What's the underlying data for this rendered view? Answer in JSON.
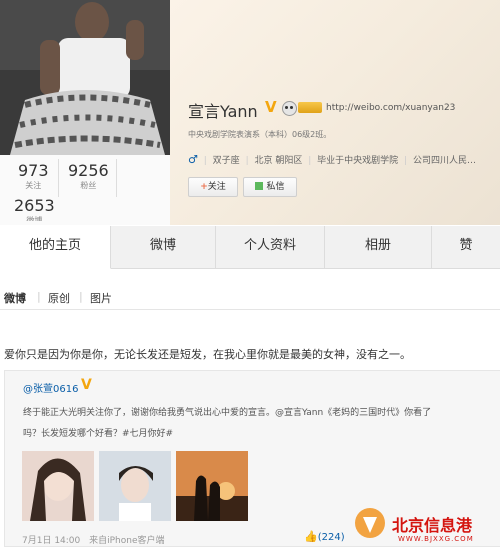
{
  "profile": {
    "name": "宣言Yann",
    "url": "http://weibo.com/xuanyan23",
    "bio": "中央戏剧学院表演系（本科）06级2班。",
    "info": [
      "双子座",
      "北京 朝阳区",
      "毕业于中央戏剧学院",
      "公司四川人民…"
    ],
    "follow_label": "关注",
    "message_label": "私信"
  },
  "stats": {
    "following_count": "973",
    "following_label": "关注",
    "fans_count": "9256",
    "fans_label": "粉丝",
    "posts_count": "2653",
    "posts_label": "微博"
  },
  "tabs": [
    "他的主页",
    "微博",
    "个人资料",
    "相册",
    "赞"
  ],
  "subtabs": [
    "微博",
    "原创",
    "图片"
  ],
  "post": {
    "text": "爱你只是因为你是你，无论长发还是短发，在我心里你就是最美的女神，没有之一。",
    "quote_author": "@张萱0616",
    "quote_text_line1": "终于能正大光明关注你了，谢谢你给我勇气说出心中爱的宣言。@宣言Yann《老妈的三国时代》你看了",
    "quote_text_line2": "吗？长发短发哪个好看？#七月你好#",
    "meta_date": "7月1日 14:00",
    "meta_source": "来自iPhone客户端",
    "likes": "(224)"
  },
  "watermark": {
    "brand": "北京信息港",
    "site": "WWW.BJXXG.COM"
  },
  "colors": {
    "vip_gold": "#f3a60f",
    "link_blue": "#0a5ea8",
    "accent_orange": "#eb7350"
  }
}
